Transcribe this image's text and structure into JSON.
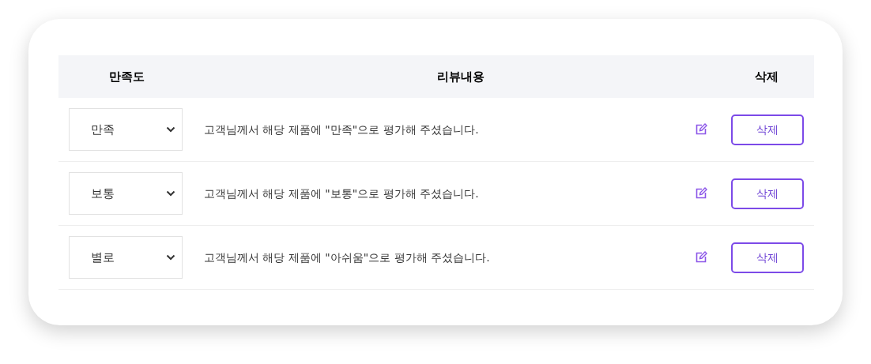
{
  "table": {
    "columns": [
      "만족도",
      "리뷰내용",
      "삭제"
    ],
    "rows": [
      {
        "rating": "만족",
        "review": "고객님께서 해당 제품에 \"만족\"으로 평가해 주셨습니다.",
        "delete": "삭제"
      },
      {
        "rating": "보통",
        "review": "고객님께서 해당 제품에 \"보통\"으로 평가해 주셨습니다.",
        "delete": "삭제"
      },
      {
        "rating": "별로",
        "review": "고객님께서 해당 제품에 \"아쉬움\"으로 평가해 주셨습니다.",
        "delete": "삭제"
      }
    ]
  }
}
